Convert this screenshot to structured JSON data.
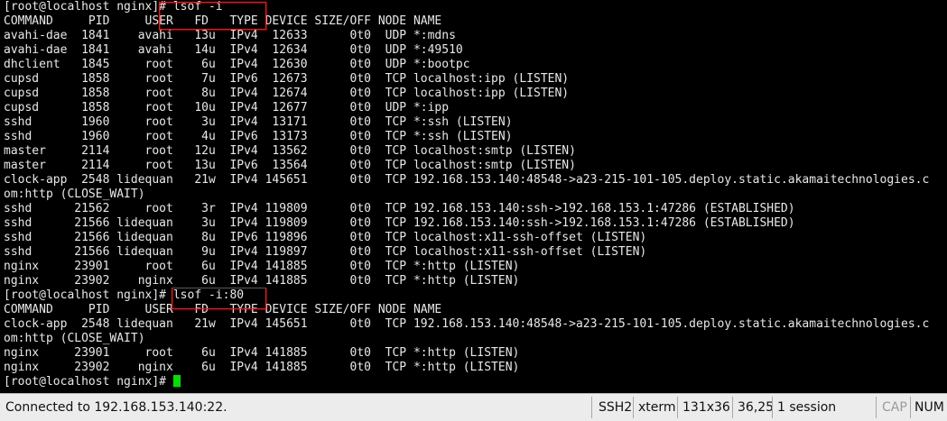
{
  "terminal": {
    "lines": [
      "[root@localhost nginx]# lsof -i",
      "COMMAND     PID     USER   FD   TYPE DEVICE SIZE/OFF NODE NAME",
      "avahi-dae  1841    avahi   13u  IPv4  12633      0t0  UDP *:mdns",
      "avahi-dae  1841    avahi   14u  IPv4  12634      0t0  UDP *:49510",
      "dhclient   1845     root    6u  IPv4  12630      0t0  UDP *:bootpc",
      "cupsd      1858     root    7u  IPv6  12673      0t0  TCP localhost:ipp (LISTEN)",
      "cupsd      1858     root    8u  IPv4  12674      0t0  TCP localhost:ipp (LISTEN)",
      "cupsd      1858     root   10u  IPv4  12677      0t0  UDP *:ipp",
      "sshd       1960     root    3u  IPv4  13171      0t0  TCP *:ssh (LISTEN)",
      "sshd       1960     root    4u  IPv6  13173      0t0  TCP *:ssh (LISTEN)",
      "master     2114     root   12u  IPv4  13562      0t0  TCP localhost:smtp (LISTEN)",
      "master     2114     root   13u  IPv6  13564      0t0  TCP localhost:smtp (LISTEN)",
      "clock-app  2548 lidequan   21w  IPv4 145651      0t0  TCP 192.168.153.140:48548->a23-215-101-105.deploy.static.akamaitechnologies.c",
      "om:http (CLOSE_WAIT)",
      "sshd      21562     root    3r  IPv4 119809      0t0  TCP 192.168.153.140:ssh->192.168.153.1:47286 (ESTABLISHED)",
      "sshd      21566 lidequan    3u  IPv4 119809      0t0  TCP 192.168.153.140:ssh->192.168.153.1:47286 (ESTABLISHED)",
      "sshd      21566 lidequan    8u  IPv6 119896      0t0  TCP localhost:x11-ssh-offset (LISTEN)",
      "sshd      21566 lidequan    9u  IPv4 119897      0t0  TCP localhost:x11-ssh-offset (LISTEN)",
      "nginx     23901     root    6u  IPv4 141885      0t0  TCP *:http (LISTEN)",
      "nginx     23902    nginx    6u  IPv4 141885      0t0  TCP *:http (LISTEN)",
      "[root@localhost nginx]# lsof -i:80",
      "COMMAND     PID     USER   FD   TYPE DEVICE SIZE/OFF NODE NAME",
      "clock-app  2548 lidequan   21w  IPv4 145651      0t0  TCP 192.168.153.140:48548->a23-215-101-105.deploy.static.akamaitechnologies.c",
      "om:http (CLOSE_WAIT)",
      "nginx     23901     root    6u  IPv4 141885      0t0  TCP *:http (LISTEN)",
      "nginx     23902    nginx    6u  IPv4 141885      0t0  TCP *:http (LISTEN)"
    ],
    "prompt": "[root@localhost nginx]# ",
    "text_color": "#e8e8e8",
    "background": "#000000",
    "cursor_color": "#00e000",
    "highlight_color": "#e02020"
  },
  "statusbar": {
    "connection": "Connected to 192.168.153.140:22.",
    "protocol": "SSH2",
    "terminal_type": "xterm",
    "size": "131x36",
    "cursor_pos": "36,25",
    "sessions": "1 session",
    "caps": "CAP",
    "num": "NUM"
  }
}
